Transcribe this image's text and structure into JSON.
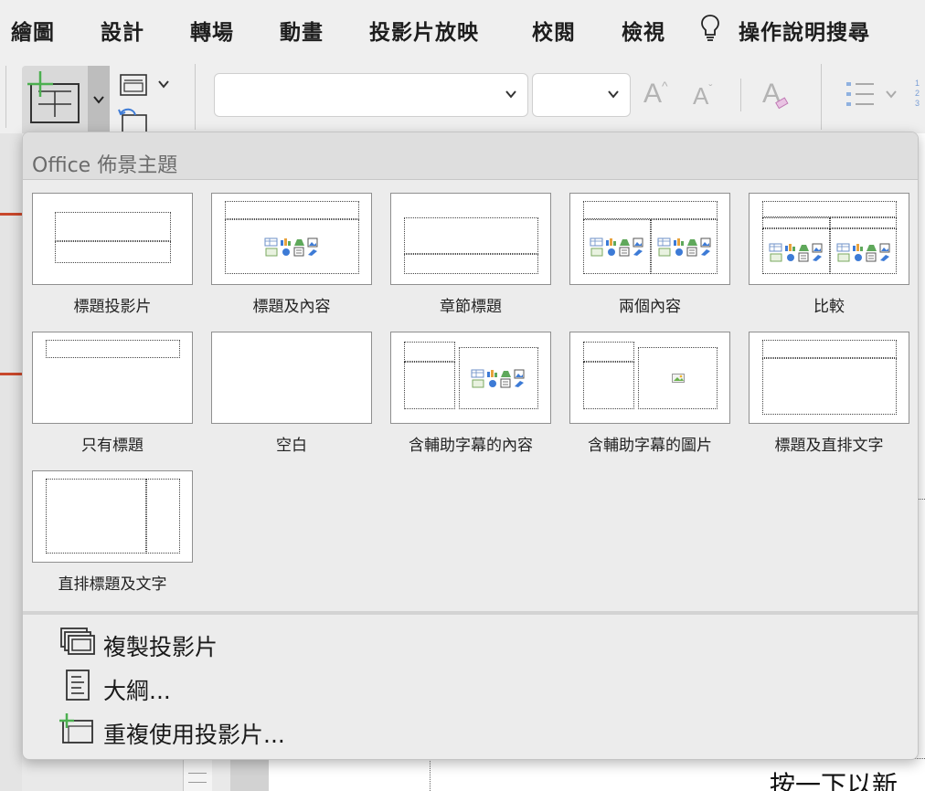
{
  "ribbon": {
    "tabs": [
      "繪圖",
      "設計",
      "轉場",
      "動畫",
      "投影片放映",
      "校閱",
      "檢視"
    ],
    "help_label": "操作說明搜尋"
  },
  "toolbar": {
    "font_name": "",
    "font_size": "",
    "grow_font": "A",
    "shrink_font": "A",
    "clear_format": "A",
    "numbering_digits": [
      "1",
      "2",
      "3"
    ]
  },
  "layout_gallery": {
    "title": "Office 佈景主題",
    "layouts": [
      {
        "label": "標題投影片"
      },
      {
        "label": "標題及內容"
      },
      {
        "label": "章節標題"
      },
      {
        "label": "兩個內容"
      },
      {
        "label": "比較"
      },
      {
        "label": "只有標題"
      },
      {
        "label": "空白"
      },
      {
        "label": "含輔助字幕的內容"
      },
      {
        "label": "含輔助字幕的圖片"
      },
      {
        "label": "標題及直排文字"
      },
      {
        "label": "直排標題及文字"
      }
    ],
    "commands": [
      {
        "label": "複製投影片",
        "icon": "duplicate-slide-icon"
      },
      {
        "label": "大綱...",
        "icon": "outline-document-icon"
      },
      {
        "label": "重複使用投影片...",
        "icon": "reuse-slide-icon"
      }
    ]
  },
  "slide": {
    "placeholder_text": "按一下以新"
  },
  "colors": {
    "accent_green": "#4caf50",
    "accent_orange": "#c8472b",
    "icon_blue": "#3d7bd6"
  }
}
